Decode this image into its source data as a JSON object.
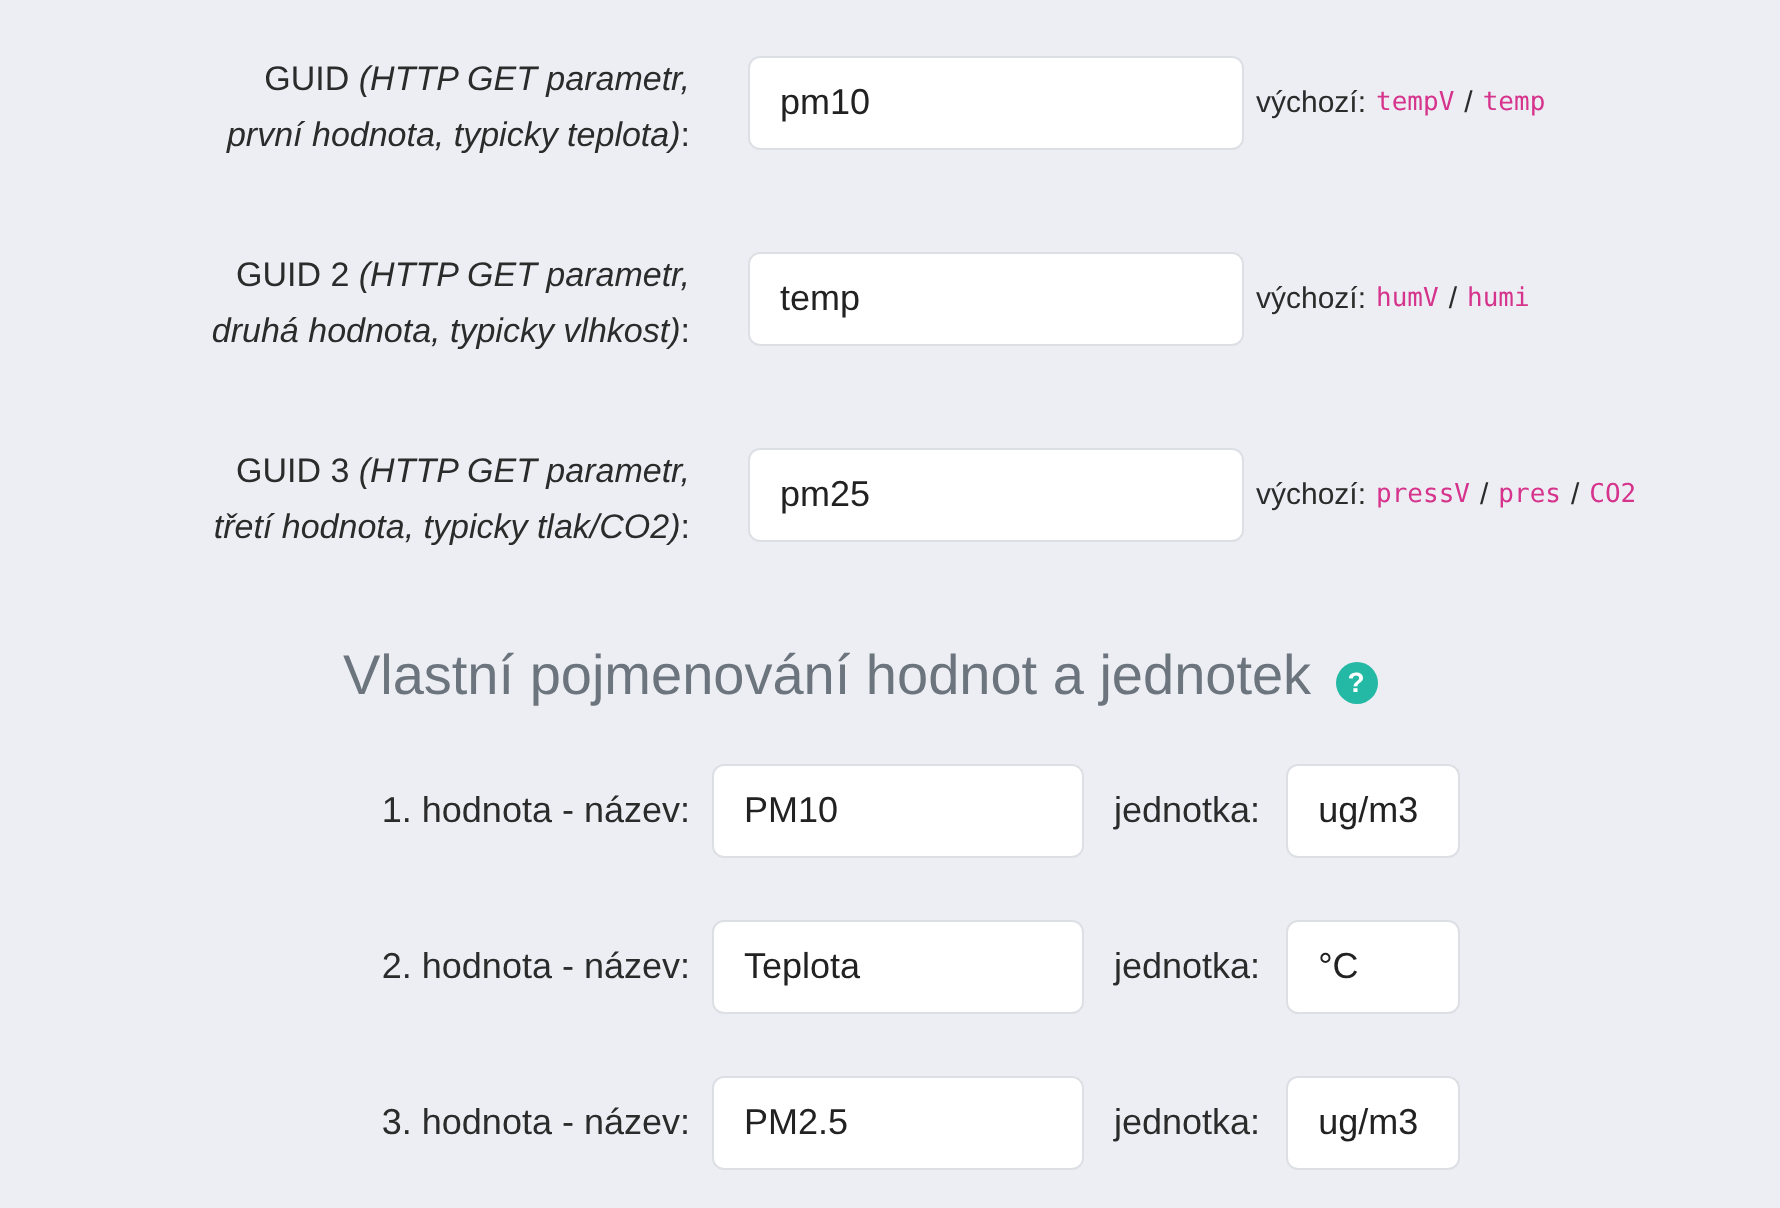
{
  "guid_fields": [
    {
      "label": "GUID *(HTTP GET parametr, první hodnota, typicky teplota)*:",
      "value": "pm10",
      "hint": [
        {
          "kind": "text",
          "text": "výchozí:"
        },
        {
          "kind": "code",
          "text": "tempV"
        },
        {
          "kind": "separator",
          "text": "/"
        },
        {
          "kind": "code",
          "text": "temp"
        }
      ]
    },
    {
      "label": "GUID 2 *(HTTP GET parametr, druhá hodnota, typicky vlhkost)*:",
      "value": "temp",
      "hint": [
        {
          "kind": "text",
          "text": "výchozí:"
        },
        {
          "kind": "code",
          "text": "humV"
        },
        {
          "kind": "separator",
          "text": "/"
        },
        {
          "kind": "code",
          "text": "humi"
        }
      ]
    },
    {
      "label": "GUID 3 *(HTTP GET parametr, třetí hodnota, typicky tlak/CO2)*:",
      "value": "pm25",
      "hint": [
        {
          "kind": "text",
          "text": "výchozí:"
        },
        {
          "kind": "code",
          "text": "pressV"
        },
        {
          "kind": "separator",
          "text": "/"
        },
        {
          "kind": "code",
          "text": "pres"
        },
        {
          "kind": "separator",
          "text": "/"
        },
        {
          "kind": "code",
          "text": "CO2"
        }
      ]
    }
  ],
  "section": {
    "title": "Vlastní pojmenování hodnot a jednotek",
    "help_icon": "?"
  },
  "value_names": [
    {
      "label": "1. hodnota - název:",
      "name": "PM10",
      "unit_label": "jednotka:",
      "unit": "ug/m3"
    },
    {
      "label": "2. hodnota - název:",
      "name": "Teplota",
      "unit_label": "jednotka:",
      "unit": "°C"
    },
    {
      "label": "3. hodnota - název:",
      "name": "PM2.5",
      "unit_label": "jednotka:",
      "unit": "ug/m3"
    }
  ]
}
